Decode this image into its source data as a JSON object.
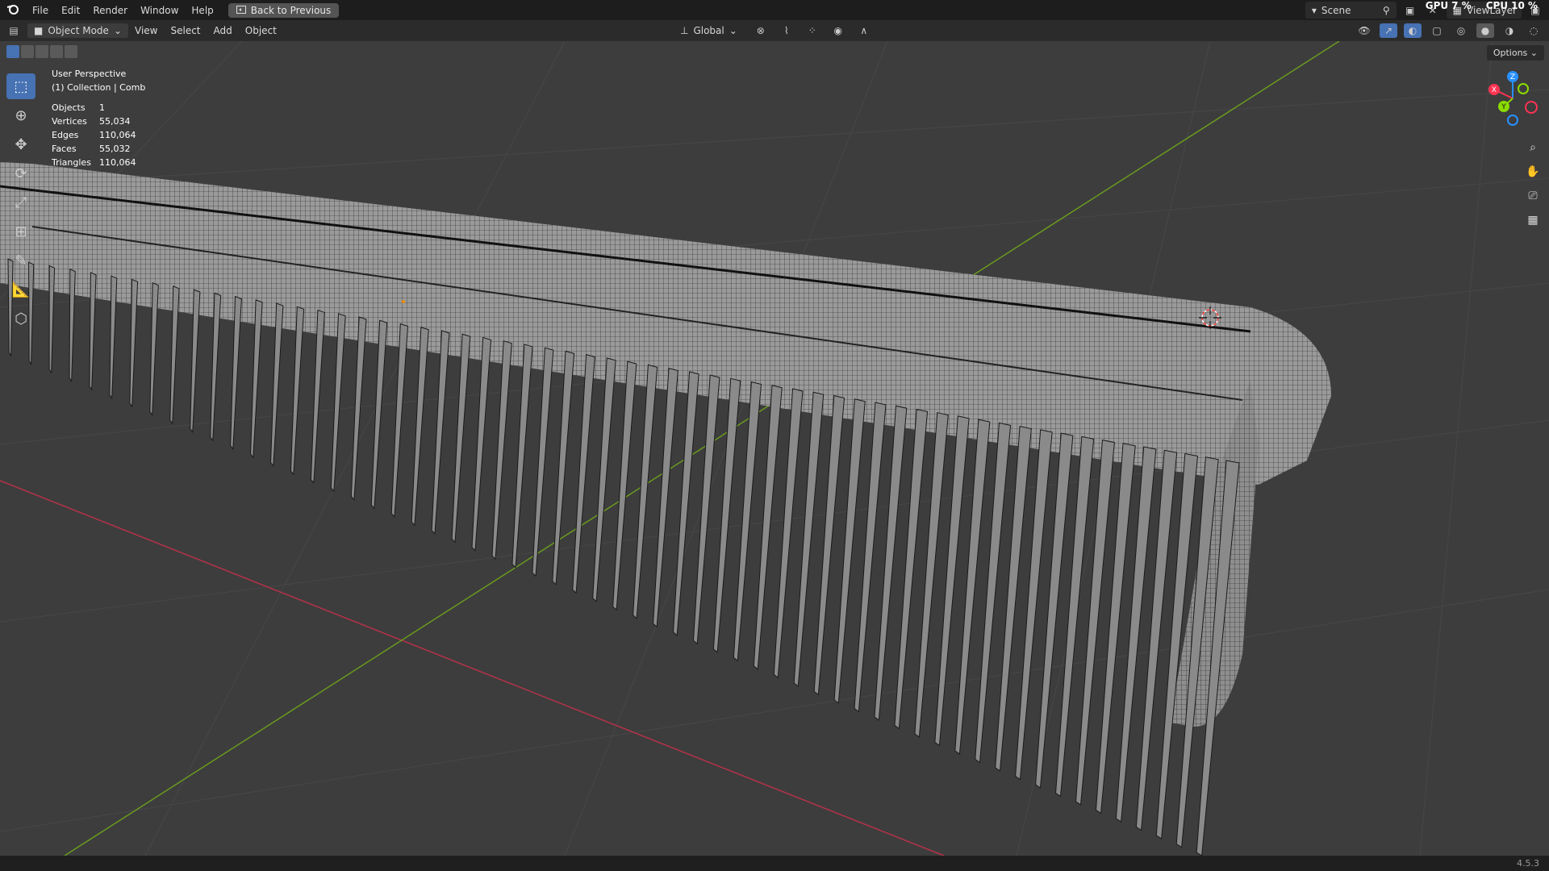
{
  "topbar": {
    "menus": [
      "File",
      "Edit",
      "Render",
      "Window",
      "Help"
    ],
    "back_label": "Back to Previous",
    "scene_label": "Scene",
    "viewlayer_label": "ViewLayer",
    "gpu_label": "GPU",
    "gpu_value": "7 %",
    "cpu_label": "CPU",
    "cpu_value": "10 %"
  },
  "header": {
    "mode_label": "Object Mode",
    "menus": [
      "View",
      "Select",
      "Add",
      "Object"
    ],
    "orientation_label": "Global"
  },
  "viewport": {
    "options_label": "Options",
    "perspective": "User Perspective",
    "collection": "(1) Collection | Comb",
    "stats": [
      {
        "label": "Objects",
        "value": "1"
      },
      {
        "label": "Vertices",
        "value": "55,034"
      },
      {
        "label": "Edges",
        "value": "110,064"
      },
      {
        "label": "Faces",
        "value": "55,032"
      },
      {
        "label": "Triangles",
        "value": "110,064"
      }
    ],
    "gizmo": {
      "x_label": "X",
      "y_label": "Y",
      "z_label": "Z"
    }
  },
  "statusbar": {
    "version": "4.5.3"
  },
  "colors": {
    "accent": "#4772b3",
    "x_axis": "#ff3352",
    "y_axis": "#8bdc00",
    "z_axis": "#2890ff"
  },
  "icons": {
    "tools": [
      "select-box-icon",
      "cursor-icon",
      "move-icon",
      "rotate-icon",
      "scale-icon",
      "transform-icon",
      "annotate-icon",
      "measure-icon",
      "add-cube-icon"
    ],
    "nav": [
      "zoom-icon",
      "pan-hand-icon",
      "camera-icon",
      "ortho-grid-icon"
    ]
  }
}
